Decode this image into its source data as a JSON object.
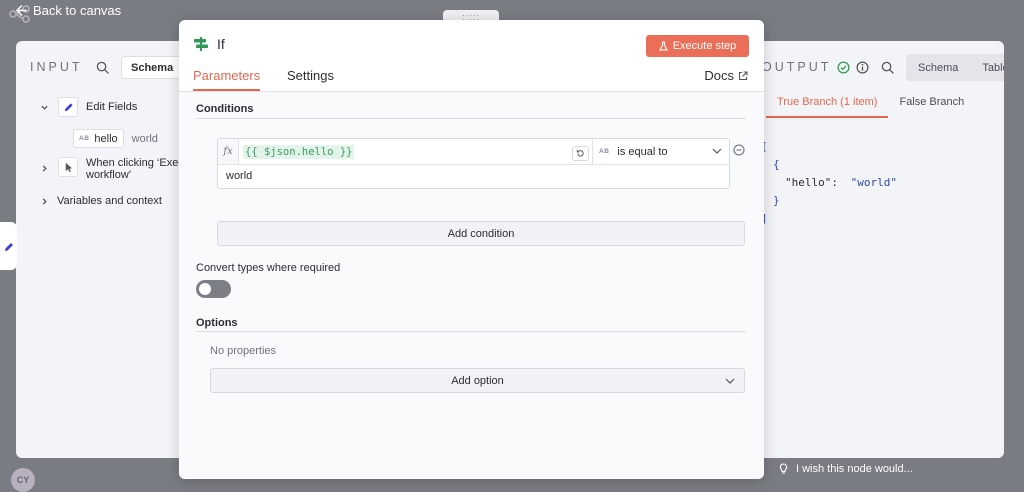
{
  "nav": {
    "back_label": "Back to canvas",
    "back_icon": "arrow-left-icon"
  },
  "user": {
    "initials": "CY"
  },
  "input_panel": {
    "heading": "INPUT",
    "view_label": "Schema",
    "tree": [
      {
        "label": "Edit Fields",
        "icon": "pencil-icon",
        "expanded": true
      },
      {
        "field_type": "AB",
        "field_name": "hello",
        "field_value": "world"
      },
      {
        "label_line1": "When clicking ‘Exec",
        "label_line2": "workflow’",
        "icon": "pointer-icon",
        "expanded": false
      },
      {
        "label": "Variables and context",
        "expanded": false
      }
    ]
  },
  "node": {
    "title": "If",
    "execute_label": "Execute step",
    "tabs": [
      {
        "label": "Parameters",
        "active": true
      },
      {
        "label": "Settings",
        "active": false
      }
    ],
    "docs_label": "Docs",
    "conditions": {
      "heading": "Conditions",
      "fx_label": "fx",
      "left_value": "{{ $json.hello }}",
      "operator_type": "AB",
      "operator": "is equal to",
      "right_value": "world",
      "add_label": "Add condition"
    },
    "convert": {
      "label": "Convert types where required",
      "enabled": false
    },
    "options": {
      "heading": "Options",
      "empty_text": "No properties",
      "add_label": "Add option"
    }
  },
  "output_panel": {
    "heading": "OUTPUT",
    "views": [
      "Schema",
      "Table"
    ],
    "branches": [
      {
        "label": "True Branch (1 item)",
        "active": true
      },
      {
        "label": "False Branch",
        "active": false
      }
    ],
    "json": {
      "open": "[",
      "obj_open": "{",
      "key": "\"hello\":",
      "value": "\"world\"",
      "obj_close": "}",
      "close": "]"
    }
  },
  "feedback": {
    "text": "I wish this node would..."
  },
  "colors": {
    "accent": "#e4674e",
    "execute": "#eb6e58",
    "success": "#2d9d4e",
    "json_string": "#2e49a8",
    "expression_bg": "#e3f4ea"
  }
}
